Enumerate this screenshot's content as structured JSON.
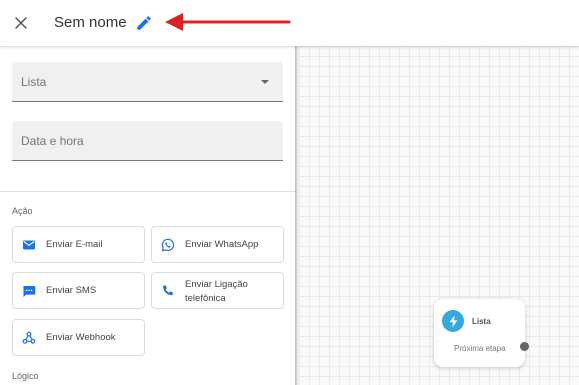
{
  "header": {
    "title": "Sem nome"
  },
  "form": {
    "list_label": "Lista",
    "datetime_label": "Data e hora"
  },
  "sections": {
    "action": "Ação",
    "logic": "Lógico"
  },
  "actions": {
    "email": "Enviar E-mail",
    "whatsapp": "Enviar WhatsApp",
    "sms": "Enviar SMS",
    "call_line1": "Enviar Ligação",
    "call_line2": "telefônica",
    "webhook": "Enviar Webhook"
  },
  "node": {
    "title": "Lista",
    "next_step": "Próxima etapa"
  },
  "colors": {
    "accent_blue": "#1a73e8",
    "annotation_red": "#e02020",
    "node_icon": "#34a9dd"
  },
  "icons": {
    "close": "close-icon",
    "edit": "pencil-icon",
    "email": "mail-icon",
    "whatsapp": "whatsapp-icon",
    "sms": "chat-icon",
    "call": "phone-icon",
    "webhook": "webhook-icon",
    "node": "lightning-icon"
  }
}
